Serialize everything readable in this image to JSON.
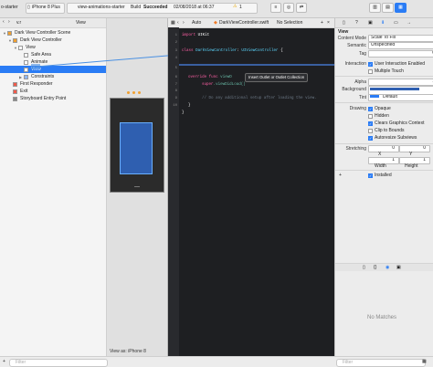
{
  "toolbar": {
    "project": "o-starter",
    "scheme_target": "iPhone 8 Plus",
    "activity_project": "view-animations-starter",
    "build_prefix": "Build",
    "build_status": "Succeeded",
    "build_time": "02/08/2018 at 06:37",
    "warning_count": "1"
  },
  "navigator": {
    "tabs": [
      "v.r",
      "View"
    ],
    "tree": [
      {
        "label": "Dark View Controller Scene",
        "level": 0,
        "icon": "scene-icon",
        "selected": false
      },
      {
        "label": "Dark View Controller",
        "level": 1,
        "icon": "view-controller-icon",
        "selected": false
      },
      {
        "label": "View",
        "level": 2,
        "icon": "view-icon",
        "selected": false
      },
      {
        "label": "Safe Area",
        "level": 3,
        "icon": "view-icon",
        "selected": false
      },
      {
        "label": "Animate",
        "level": 3,
        "icon": "button-icon",
        "selected": false
      },
      {
        "label": "View",
        "level": 3,
        "icon": "view-icon",
        "selected": true
      },
      {
        "label": "Constraints",
        "level": 3,
        "icon": "constraints-icon",
        "selected": false
      },
      {
        "label": "First Responder",
        "level": 1,
        "icon": "first-responder-icon",
        "selected": false
      },
      {
        "label": "Exit",
        "level": 1,
        "icon": "exit-icon",
        "selected": false
      },
      {
        "label": "Storyboard Entry Point",
        "level": 1,
        "icon": "entry-point-icon",
        "selected": false
      }
    ],
    "filter_placeholder": "Filter"
  },
  "canvas": {
    "device_label": "View as: iPhone 8"
  },
  "editor": {
    "breadcrumb_prev": "Auto",
    "breadcrumb_file": "DarkViewController.swift",
    "breadcrumb_selection": "No Selection",
    "tooltip": "Insert Outlet or Outlet Collection",
    "line_numbers": [
      "1",
      "2",
      "3",
      "4",
      "5",
      "6",
      "7",
      "8",
      "9",
      "10"
    ],
    "lines": {
      "l1_kw": "import",
      "l1_rest": " UIKit",
      "l3_kw": "class",
      "l3_name": " DarkViewController",
      "l3_colon": ": ",
      "l3_super": "UIViewController",
      "l3_brace": " {",
      "l5_kw": "override func",
      "l5_fn": " viewD",
      "l6_super": "super",
      "l6_call": ".viewDidLoad()",
      "l8_comment": "// Do any additional setup after loading the view.",
      "l9": "}",
      "l10": "}"
    }
  },
  "inspector": {
    "section_title": "View",
    "content_mode_label": "Content Mode",
    "content_mode_value": "Scale To Fill",
    "semantic_label": "Semantic",
    "semantic_value": "Unspecified",
    "tag_label": "Tag",
    "tag_value": "0",
    "interaction_label": "Interaction",
    "user_interaction": "User Interaction Enabled",
    "multiple_touch": "Multiple Touch",
    "alpha_label": "Alpha",
    "alpha_value": "1",
    "background_label": "Background",
    "tint_label": "Tint",
    "tint_value": "Default",
    "drawing_label": "Drawing",
    "opaque": "Opaque",
    "hidden": "Hidden",
    "clears_context": "Clears Graphics Context",
    "clip_bounds": "Clip to Bounds",
    "autoresize": "Autoresize Subviews",
    "stretching_label": "Stretching",
    "stretch_x": "0",
    "stretch_y": "0",
    "stretch_w": "1",
    "stretch_h": "1",
    "x_label": "X",
    "y_label": "Y",
    "width_label": "Width",
    "height_label": "Height",
    "installed": "Installed",
    "no_matches": "No Matches",
    "filter_placeholder": "Filter"
  },
  "colors": {
    "selection_blue": "#2a7cf5",
    "view_blue": "#2f5fb0",
    "editor_bg": "#1e1f22"
  }
}
